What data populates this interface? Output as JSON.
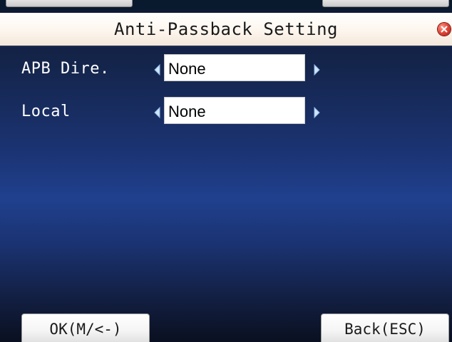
{
  "header": {
    "title": "Anti-Passback Setting"
  },
  "settings": [
    {
      "label": "APB Dire.",
      "value": "None"
    },
    {
      "label": "Local",
      "value": "None"
    }
  ],
  "footer": {
    "ok_label": "OK(M/<-)",
    "back_label": "Back(ESC)"
  },
  "icons": {
    "close": "close-icon",
    "left_arrow": "arrow-left-icon",
    "right_arrow": "arrow-right-icon"
  },
  "colors": {
    "title_bar": "#fdf6ee",
    "background": "#1b3474",
    "close_button": "#e24a3a",
    "value_box": "#ffffff"
  }
}
